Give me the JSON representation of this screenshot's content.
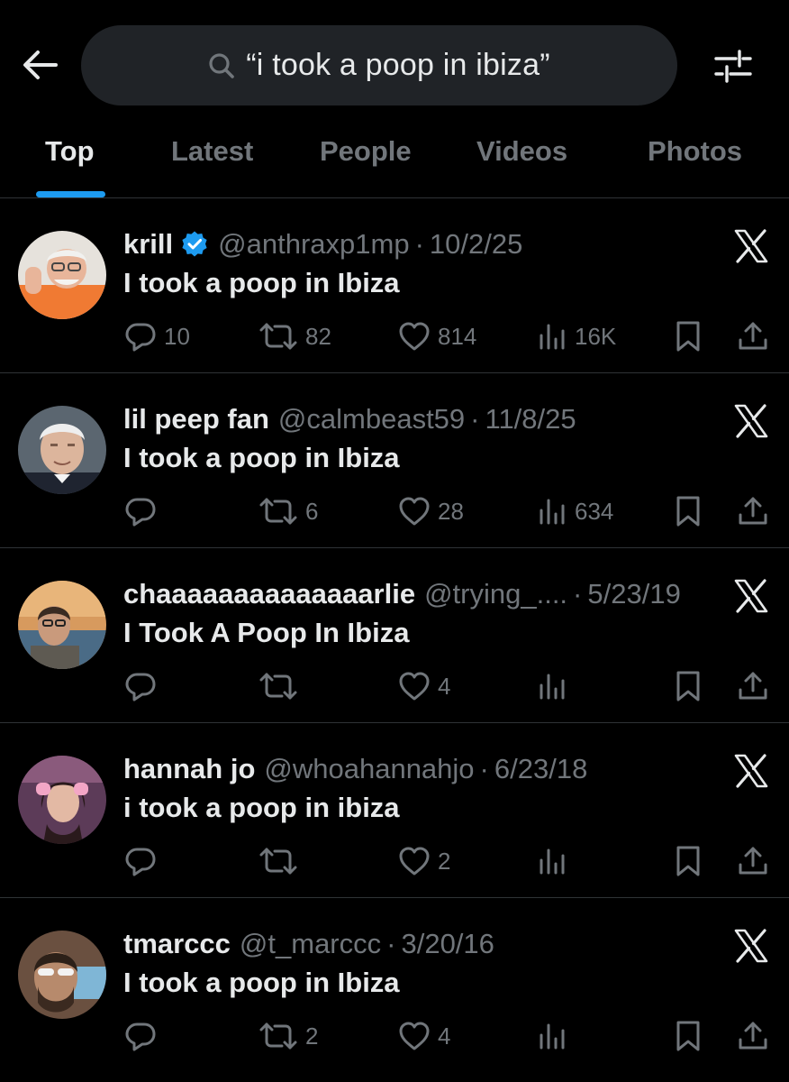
{
  "search": {
    "query": "“i took a poop in ibiza”"
  },
  "tabs": [
    {
      "label": "Top",
      "active": true
    },
    {
      "label": "Latest",
      "active": false
    },
    {
      "label": "People",
      "active": false
    },
    {
      "label": "Videos",
      "active": false
    },
    {
      "label": "Photos",
      "active": false
    }
  ],
  "colors": {
    "background": "#000000",
    "text_primary": "#e7e9ea",
    "text_secondary": "#71767b",
    "accent": "#1d9bf0",
    "search_bg": "#202327",
    "divider": "#2f3336"
  },
  "tweets": [
    {
      "display_name": "krill",
      "verified": true,
      "handle": "@anthraxp1mp",
      "separator": "·",
      "date": "10/2/25",
      "text": "I took a poop in Ibiza",
      "replies": "10",
      "retweets": "82",
      "likes": "814",
      "views": "16K",
      "source_icon": "x-logo-icon"
    },
    {
      "display_name": "lil peep fan",
      "verified": false,
      "handle": "@calmbeast59",
      "separator": "·",
      "date": "11/8/25",
      "text": "I took a poop in Ibiza",
      "replies": "",
      "retweets": "6",
      "likes": "28",
      "views": "634",
      "source_icon": "x-logo-icon"
    },
    {
      "display_name": "chaaaaaaaaaaaaaarlie",
      "verified": false,
      "handle": "@trying_....",
      "separator": "·",
      "date": "5/23/19",
      "text": "I Took A Poop In Ibiza",
      "replies": "",
      "retweets": "",
      "likes": "4",
      "views": "",
      "source_icon": "x-logo-icon"
    },
    {
      "display_name": "hannah jo",
      "verified": false,
      "handle": "@whoahannahjo",
      "separator": "·",
      "date": "6/23/18",
      "text": "i took a poop in ibiza",
      "replies": "",
      "retweets": "",
      "likes": "2",
      "views": "",
      "source_icon": "x-logo-icon"
    },
    {
      "display_name": "tmarccc",
      "verified": false,
      "handle": "@t_marccc",
      "separator": "·",
      "date": "3/20/16",
      "text": "I took a poop in Ibiza",
      "replies": "",
      "retweets": "2",
      "likes": "4",
      "views": "",
      "source_icon": "x-logo-icon"
    }
  ]
}
